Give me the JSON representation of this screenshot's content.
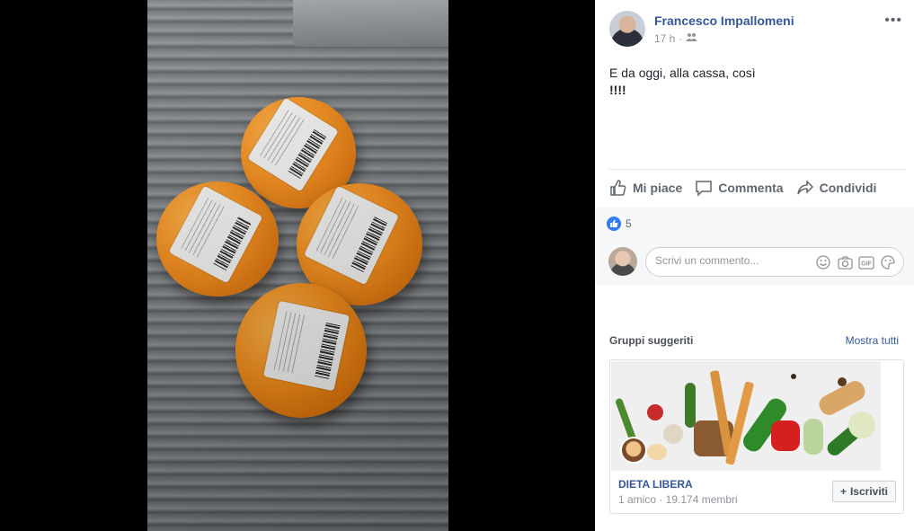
{
  "post": {
    "author": "Francesco Impallomeni",
    "time": "17 h",
    "privacy_icon": "friends-icon",
    "text_line1": "E da oggi, alla cassa, così",
    "text_line2": "!!!!",
    "more_label": "•••"
  },
  "actions": {
    "like": "Mi piace",
    "comment": "Commenta",
    "share": "Condividi"
  },
  "reactions": {
    "count": "5",
    "icon": "like-icon"
  },
  "comment_input": {
    "placeholder": "Scrivi un commento...",
    "value": "",
    "icons": [
      "emoji-icon",
      "camera-icon",
      "gif-icon",
      "sticker-icon"
    ]
  },
  "suggested_groups": {
    "title": "Gruppi suggeriti",
    "show_all": "Mostra tutti",
    "group": {
      "name": "DIETA LIBERA",
      "meta": "1 amico · 19.174 membri",
      "join_label": "Iscriviti"
    }
  },
  "colors": {
    "link": "#365899",
    "like_blue": "#2f7cf6",
    "text_dark": "#1d2129",
    "text_muted": "#90949c"
  }
}
